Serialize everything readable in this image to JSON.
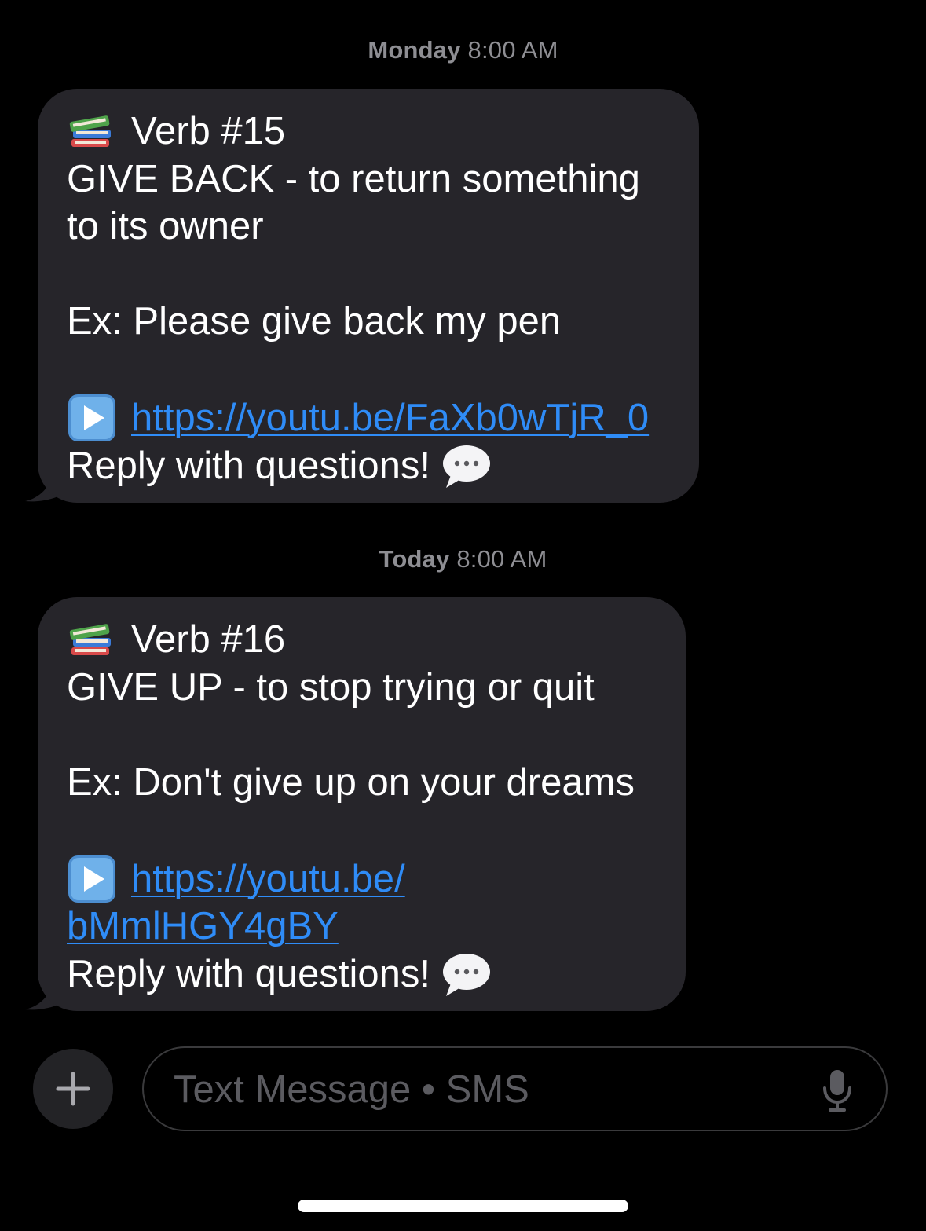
{
  "conversation": {
    "messages": [
      {
        "timestamp_day": "Monday",
        "timestamp_time": "8:00 AM",
        "title_icon": "books-emoji",
        "title": "Verb #15",
        "definition_line1": "GIVE BACK - to return something",
        "definition_line2": "to its owner",
        "example": "Ex: Please give back my pen",
        "link_icon": "play-button-emoji",
        "link_line1": "https://youtu.be/FaXb0wTjR_0",
        "closing": "Reply with questions!",
        "closing_icon": "speech-balloon-emoji"
      },
      {
        "timestamp_day": "Today",
        "timestamp_time": "8:00 AM",
        "title_icon": "books-emoji",
        "title": "Verb #16",
        "definition_line1": "GIVE UP - to stop trying or quit",
        "example": "Ex: Don't give up on your dreams",
        "link_icon": "play-button-emoji",
        "link_line1": "https://youtu.be/",
        "link_line2": "bMmlHGY4gBY",
        "closing": "Reply with questions!",
        "closing_icon": "speech-balloon-emoji"
      }
    ]
  },
  "composer": {
    "add_icon": "plus-icon",
    "placeholder": "Text Message • SMS",
    "mic_icon": "microphone-icon"
  },
  "colors": {
    "background": "#000000",
    "bubble": "#26252a",
    "link": "#2f8cf7",
    "timestamp": "#8e8e93",
    "placeholder": "#5b5b60"
  }
}
